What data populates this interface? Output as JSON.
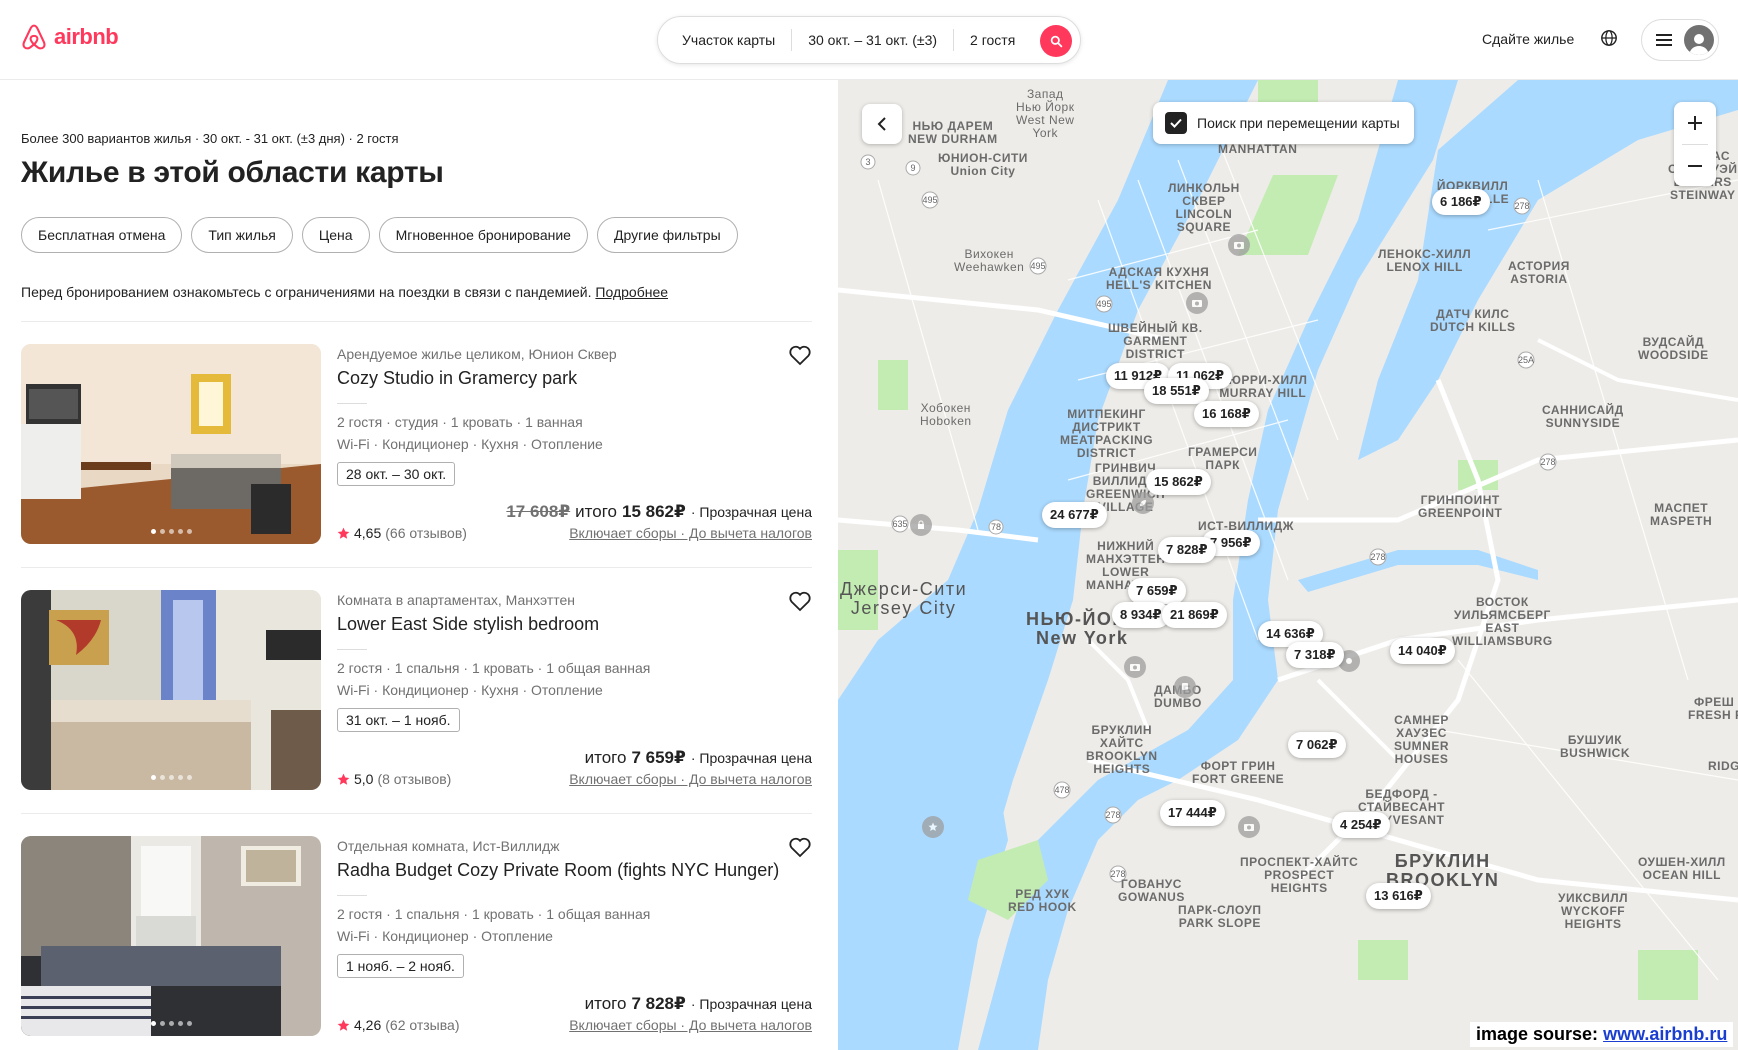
{
  "header": {
    "brand": "airbnb",
    "search": {
      "location": "Участок карты",
      "dates": "30 окт. – 31 окт. (±3)",
      "guests": "2 гостя"
    },
    "host_link": "Сдайте жилье"
  },
  "results": {
    "summary": "Более 300 вариантов жилья · 30 окт. - 31 окт. (±3 дня) · 2 гостя",
    "title": "Жилье в этой области карты",
    "filters": [
      "Бесплатная отмена",
      "Тип жилья",
      "Цена",
      "Мгновенное бронирование",
      "Другие фильтры"
    ],
    "notice": "Перед бронированием ознакомьтесь с ограничениями на поездки в связи с пандемией.",
    "notice_link": "Подробнее"
  },
  "listings": [
    {
      "type": "Арендуемое жилье целиком, Юнион Сквер",
      "title": "Cozy Studio in Gramercy park",
      "specs": "2 гостя · студия · 1 кровать · 1 ванная",
      "amenities": "Wi-Fi · Кондиционер · Кухня · Отопление",
      "dates": "28 окт. – 30 окт.",
      "old_price": "17 608₽",
      "total_prefix": "итого",
      "price": "15 862₽",
      "price_note": "· Прозрачная цена",
      "rating": "4,65",
      "reviews": "(66 отзывов)",
      "fees": "Включает сборы · До вычета налогов"
    },
    {
      "type": "Комната в апартаментах, Манхэттен",
      "title": "Lower East Side stylish bedroom",
      "specs": "2 гостя · 1 спальня · 1 кровать · 1 общая ванная",
      "amenities": "Wi-Fi · Кондиционер · Кухня · Отопление",
      "dates": "31 окт. – 1 нояб.",
      "old_price": "",
      "total_prefix": "итого",
      "price": "7 659₽",
      "price_note": "· Прозрачная цена",
      "rating": "5,0",
      "reviews": "(8 отзывов)",
      "fees": "Включает сборы · До вычета налогов"
    },
    {
      "type": "Отдельная комната, Ист-Виллидж",
      "title": "Radha Budget Cozy Private Room (fights NYC Hunger)",
      "specs": "2 гостя · 1 спальня · 1 кровать · 1 общая ванная",
      "amenities": "Wi-Fi · Кондиционер · Отопление",
      "dates": "1 нояб. – 2 нояб.",
      "old_price": "",
      "total_prefix": "итого",
      "price": "7 828₽",
      "price_note": "· Прозрачная цена",
      "rating": "4,26",
      "reviews": "(62 отзыва)",
      "fees": "Включает сборы · До вычета налогов"
    }
  ],
  "map": {
    "search_on_move": "Поиск при перемещении карты",
    "search_on_move_checked": true,
    "prices": [
      "6 186₽",
      "11 912₽",
      "11 062₽",
      "18 551₽",
      "16 168₽",
      "15 862₽",
      "24 677₽",
      "7 828₽",
      "7 956₽",
      "7 659₽",
      "8 934₽",
      "21 869₽",
      "14 636₽",
      "7 318₽",
      "14 040₽",
      "7 062₽",
      "17 444₽",
      "4 254₽",
      "13 616₽"
    ],
    "labels": {
      "union_city": "ЮНИОН-СИТИ\nUnion City",
      "weehawken": "Вихокен\nWeehawken",
      "hoboken": "Хобокен\nHoboken",
      "jersey_city": "Джерси-Сити\nJersey City",
      "new_york": "НЬЮ-ЙОРК\nNew York",
      "brooklyn": "БРУКЛИН\nBROOKLYN",
      "manhattan": "МАНХЭТТЕН\nMANHATTAN",
      "yorkville": "ЙОРКВИЛЛ\nYORKVILLE",
      "lincoln_square": "ЛИНКОЛЬН\nСКВЕР\nLINCOLN\nSQUARE",
      "lenox_hill": "ЛЕНОКС-ХИЛЛ\nLENOX HILL",
      "hells_kitchen": "АДСКАЯ КУХНЯ\nHELL'S KITCHEN",
      "garment": "ШВЕЙНЫЙ КВ.\nGARMENT\nDISTRICT",
      "murray_hill": "МЮРРИ-ХИЛЛ\nMURRAY HILL",
      "meatpacking": "МИТПЕКИНГ\nДИСТРИКТ\nMEATPACKING\nDISTRICT",
      "gramercy": "ГРАМЕРСИ\nПАРК",
      "greenwich": "ГРИНВИЧ\nВИЛЛИДЖ\nGREENWICH\nVILLAGE",
      "east_village": "ИСТ-ВИЛЛИДЖ",
      "lower_manhattan": "НИЖНИЙ\nМАНХЭТТЕН\nLOWER\nMANHATTAN",
      "astoria": "АСТОРИЯ\nASTORIA",
      "dutch_kills": "ДАТЧ КИЛС\nDUTCH KILLS",
      "woodside": "ВУДСАЙД\nWOODSIDE",
      "sunnyside": "САННИСАЙД\nSUNNYSIDE",
      "greenpoint": "ГРИНПОИНТ\nGREENPOINT",
      "maspeth": "МАСПЕТ\nMASPETH",
      "williamsburg": "ВОСТОК\nУИЛЬЯМСБЕРГ\nEAST\nWILLIAMSBURG",
      "dumbo": "ДАМБО\nDUMBO",
      "brooklyn_heights": "БРУКЛИН\nХАЙТС\nBROOKLYN\nHEIGHTS",
      "fort_greene": "ФОРТ ГРИН\nFORT GREENE",
      "sumner": "САМНЕР\nХАУЗЕС\nSUMNER\nHOUSES",
      "bushwick": "БУШУИК\nBUSHWICK",
      "bedford": "БЕДФОРД -\nСТАЙВЕСАНТ\nSTUYVESANT",
      "prospect": "ПРОСПЕКТ-ХАЙТС\nPROSPECT\nHEIGHTS",
      "red_hook": "РЕД ХУК\nRED HOOK",
      "gowanus": "ГОВАНУС\nGOWANUS",
      "park_slope": "ПАРК-СЛОУП\nPARK SLOPE",
      "new_durham": "НЬЮ ДАРЕМ\nNEW DURHAM",
      "west_ny": "Запад\nНью Йорк\nWest New\nYork",
      "ditmars": "ДИТМАС\nСТЕЙНУЭЙ\nDITMARS\nSTEINWAY",
      "ridgewood": "RIDGEWO",
      "fresh_pond": "ФРЕШ П\nFRESH PO",
      "ocean_hill": "ОУШЕН-ХИЛЛ\nOCEAN HILL",
      "wyckoff": "УИКСВИЛЛ\nWYCKOFF\nHEIGHTS"
    },
    "water_color": "#aadaff",
    "park_color": "#c3ecb2"
  },
  "source": {
    "prefix": "image sourse:",
    "link": "www.airbnb.ru"
  }
}
